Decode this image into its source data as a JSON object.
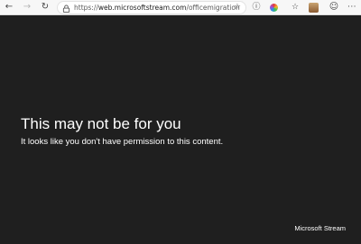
{
  "browser": {
    "url_scheme": "https://",
    "url_host": "web.microsoftstream.com",
    "url_path": "/officemigration",
    "icons": {
      "back": "back-arrow-icon",
      "forward": "forward-arrow-icon",
      "refresh": "refresh-icon",
      "lock": "lock-icon",
      "favorite": "star-icon",
      "info": "info-icon",
      "extension": "color-wheel-icon",
      "favorites": "favorites-icon",
      "profile": "avatar-icon",
      "feedback": "smiley-icon",
      "menu": "more-icon"
    }
  },
  "content": {
    "title": "This may not be for you",
    "message": "It looks like you don't have permission to this content."
  },
  "footer": {
    "brand": "Microsoft Stream"
  },
  "colors": {
    "background": "#1f1f1f",
    "text": "#ffffff",
    "toolbar": "#f7f7f7"
  }
}
